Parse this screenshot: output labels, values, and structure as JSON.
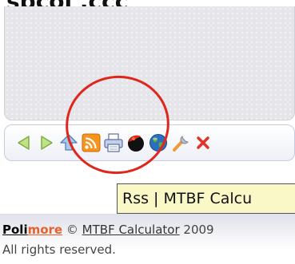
{
  "heading": {
    "text": "spcoi  .ccc"
  },
  "toolbar": {
    "buttons": [
      {
        "icon": "back-arrow-icon",
        "color": "#a8d66a"
      },
      {
        "icon": "forward-arrow-icon",
        "color": "#a8d66a"
      },
      {
        "icon": "home-up-icon",
        "color": "#6f9fd6"
      },
      {
        "icon": "rss-icon",
        "color": "#f7941d"
      },
      {
        "icon": "printer-icon",
        "color": "#8fa4d6"
      },
      {
        "icon": "theme-ball-icon",
        "color": "#d02010"
      },
      {
        "icon": "globe-icon",
        "color": "#2c6fbf"
      },
      {
        "icon": "wrench-icon",
        "color": "#f29a3b"
      },
      {
        "icon": "close-x-icon",
        "color": "#e2332b"
      }
    ]
  },
  "annotation": {
    "circle_color": "#e0261b"
  },
  "tooltip": {
    "text": "Rss | MTBF Calcu"
  },
  "footer": {
    "brand_part1": "Poli",
    "brand_part2": "more",
    "copyright_symbol": "©",
    "product_link": "MTBF Calculator",
    "year": "2009",
    "rights": "All rights reserved."
  }
}
